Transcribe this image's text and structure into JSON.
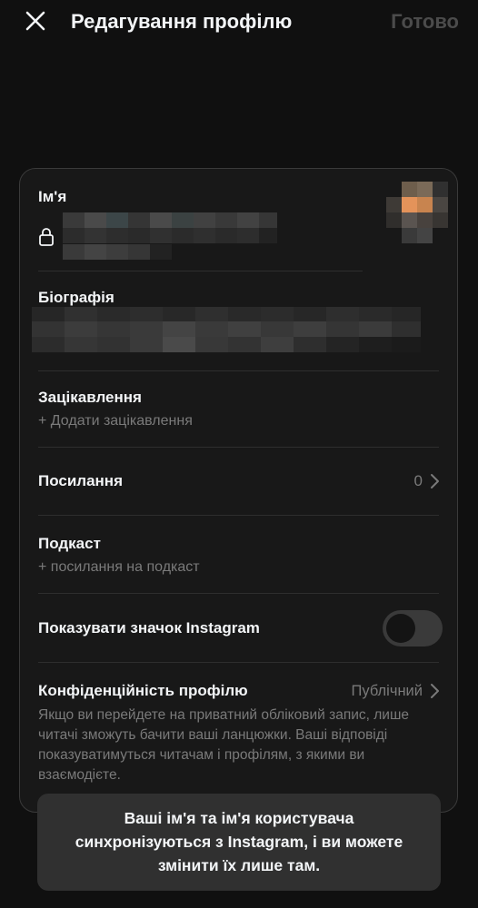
{
  "header": {
    "title": "Редагування профілю",
    "done_label": "Готово"
  },
  "profile": {
    "name_label": "Ім'я",
    "bio_label": "Біографія",
    "interests_label": "Зацікавлення",
    "interests_add": "+ Додати зацікавлення",
    "links_label": "Посилання",
    "links_count": "0",
    "podcast_label": "Подкаст",
    "podcast_add": "+ посилання на подкаст",
    "show_badge_label": "Показувати значок Instagram",
    "show_badge_enabled": false,
    "privacy_label": "Конфіденційність профілю",
    "privacy_value": "Публічний",
    "privacy_description": "Якщо ви перейдете на приватний обліковий запис, лише читачі зможуть бачити ваші ланцюжки. Ваші відповіді показуватимуться читачам і профілям, з якими ви взаємодієте."
  },
  "toast": {
    "message": "Ваші ім'я та ім'я користувача синхронізуються з Instagram, і ви можете змінити їх лише там."
  },
  "colors": {
    "background": "#101010",
    "card": "#181818",
    "text_primary": "#f3f5f7",
    "text_secondary": "#7a7a7a",
    "done_disabled": "#4b4b4b",
    "toast_bg": "#303030"
  },
  "icons": {
    "close": "close-icon",
    "lock": "lock-icon",
    "chevron": "chevron-right-icon"
  }
}
